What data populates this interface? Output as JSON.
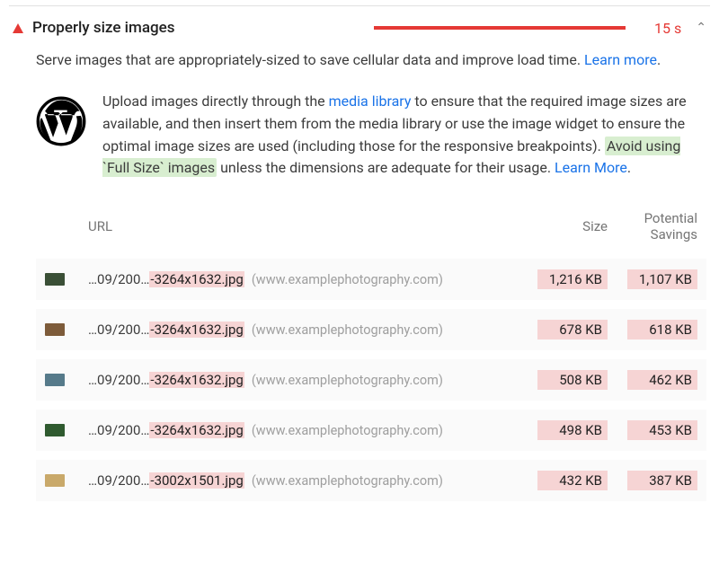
{
  "audit": {
    "title": "Properly size images",
    "time": "15 s",
    "description_pre": "Serve images that are appropriately-sized to save cellular data and improve load time. ",
    "learn_more": "Learn more",
    "tip_part1": "Upload images directly through the ",
    "tip_media_library": "media library",
    "tip_part2": " to ensure that the required image sizes are available, and then insert them from the media library or use the image widget to ensure the optimal image sizes are used (including those for the responsive breakpoints). ",
    "tip_highlight": "Avoid using `Full Size` images",
    "tip_part3": " unless the dimensions are adequate for their usage. ",
    "tip_learn_more": "Learn More",
    "columns": {
      "url": "URL",
      "size": "Size",
      "savings_top": "Potential",
      "savings_bottom": "Savings"
    },
    "rows": [
      {
        "thumb_color": "#3a4f36",
        "url_pre": "…09/200…",
        "url_hl": "-3264x1632.jpg",
        "domain": "(www.examplephotography.com)",
        "size": "1,216 KB",
        "savings": "1,107 KB"
      },
      {
        "thumb_color": "#7d5b3a",
        "url_pre": "…09/200…",
        "url_hl": "-3264x1632.jpg",
        "domain": "(www.examplephotography.com)",
        "size": "678 KB",
        "savings": "618 KB"
      },
      {
        "thumb_color": "#567a8a",
        "url_pre": "…09/200…",
        "url_hl": "-3264x1632.jpg",
        "domain": "(www.examplephotography.com)",
        "size": "508 KB",
        "savings": "462 KB"
      },
      {
        "thumb_color": "#2f5a2f",
        "url_pre": "…09/200…",
        "url_hl": "-3264x1632.jpg",
        "domain": "(www.examplephotography.com)",
        "size": "498 KB",
        "savings": "453 KB"
      },
      {
        "thumb_color": "#c9a96a",
        "url_pre": "…09/200…",
        "url_hl": "-3002x1501.jpg",
        "domain": "(www.examplephotography.com)",
        "size": "432 KB",
        "savings": "387 KB"
      }
    ]
  }
}
